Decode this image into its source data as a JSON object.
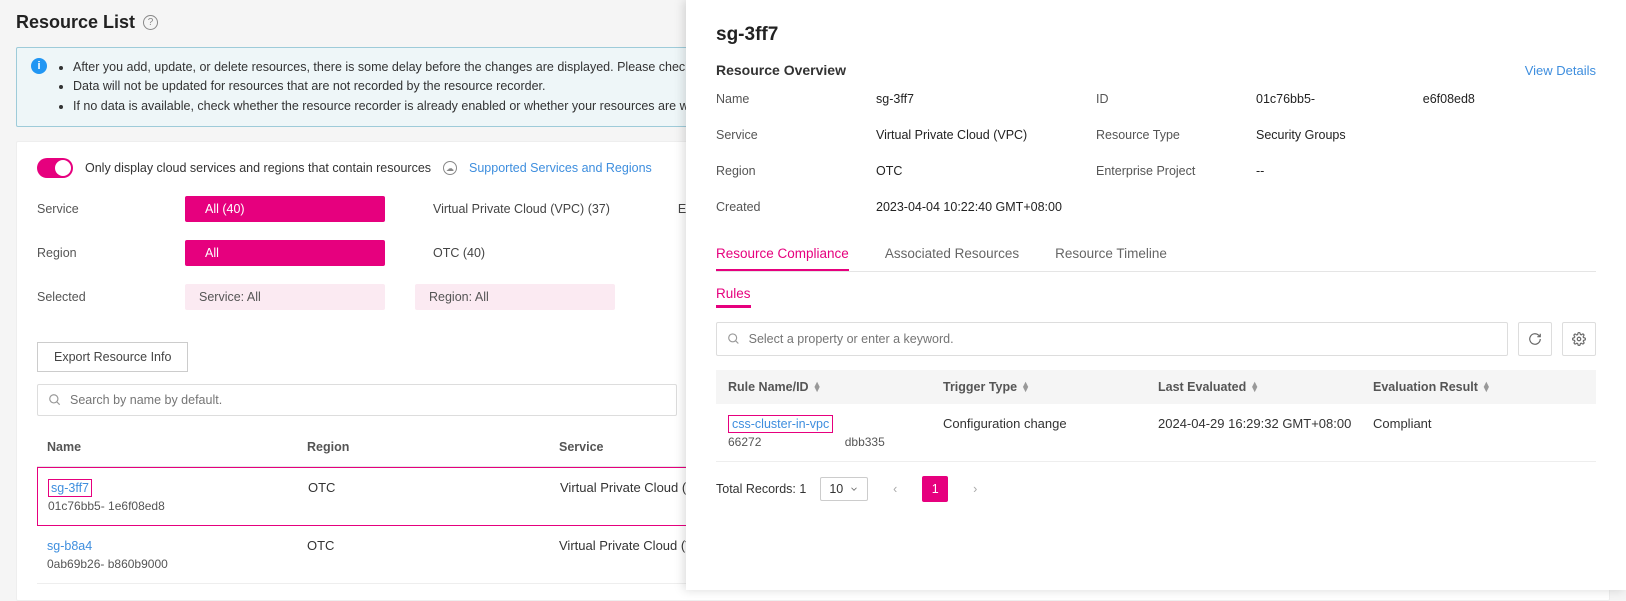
{
  "header": {
    "title": "Resource List"
  },
  "banner": {
    "items": [
      "After you add, update, or delete resources, there is some delay before the changes are displayed. Please check again l",
      "Data will not be updated for resources that are not recorded by the resource recorder.",
      "If no data is available, check whether the resource recorder is already enabled or whether your resources are within the"
    ]
  },
  "filters": {
    "toggle_label": "Only display cloud services and regions that contain resources",
    "supported_link": "Supported Services and Regions",
    "service_label": "Service",
    "service_all": "All (40)",
    "service_vpc": "Virtual Private Cloud (VPC) (37)",
    "service_elastic": "Elastic Clo",
    "region_label": "Region",
    "region_all": "All",
    "region_otc": "OTC (40)",
    "selected_label": "Selected",
    "selected_service": "Service: All",
    "selected_region": "Region: All"
  },
  "list": {
    "export_btn": "Export Resource Info",
    "search_placeholder": "Search by name by default.",
    "cols": {
      "name": "Name",
      "region": "Region",
      "service": "Service"
    },
    "rows": [
      {
        "name": "sg-3ff7",
        "id": "01c76bb5-                         1e6f08ed8",
        "region": "OTC",
        "service": "Virtual Private Cloud (V",
        "selected": true
      },
      {
        "name": "sg-b8a4",
        "id": "0ab69b26-                       b860b9000",
        "region": "OTC",
        "service": "Virtual Private Cloud (V",
        "selected": false
      }
    ]
  },
  "drawer": {
    "title": "sg-3ff7",
    "overview_label": "Resource Overview",
    "view_details": "View Details",
    "fields": {
      "name_l": "Name",
      "name_v": "sg-3ff7",
      "id_l": "ID",
      "id_v": "01c76bb5-                               e6f08ed8",
      "service_l": "Service",
      "service_v": "Virtual Private Cloud (VPC)",
      "restype_l": "Resource Type",
      "restype_v": "Security Groups",
      "region_l": "Region",
      "region_v": "OTC",
      "ep_l": "Enterprise Project",
      "ep_v": "--",
      "created_l": "Created",
      "created_v": "2023-04-04 10:22:40 GMT+08:00"
    },
    "tabs": {
      "compliance": "Resource Compliance",
      "associated": "Associated Resources",
      "timeline": "Resource Timeline"
    },
    "subtab": "Rules",
    "rules_search_placeholder": "Select a property or enter a keyword.",
    "rules_cols": {
      "name": "Rule Name/ID",
      "trigger": "Trigger Type",
      "last": "Last Evaluated",
      "result": "Evaluation Result"
    },
    "rules_row": {
      "name": "css-cluster-in-vpc",
      "id": "66272                         dbb335",
      "trigger": "Configuration change",
      "last": "2024-04-29 16:29:32 GMT+08:00",
      "result": "Compliant"
    },
    "pager": {
      "total": "Total Records: 1",
      "size": "10",
      "current": "1"
    }
  }
}
